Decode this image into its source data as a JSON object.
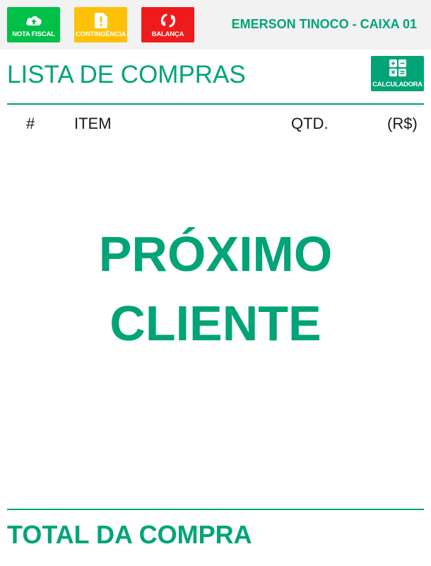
{
  "colors": {
    "primary": "#00a477",
    "nota_fiscal": "#00c04a",
    "contingencia": "#ffc107",
    "balanca": "#ef1b1b",
    "topbar_bg": "#f2f2f2"
  },
  "toolbar": {
    "nota_fiscal": {
      "label": "NOTA FISCAL",
      "icon": "cloud-upload-icon"
    },
    "contingencia": {
      "label": "CONTINGÊNCIA",
      "icon": "alert-file-icon"
    },
    "balanca": {
      "label": "BALANÇA",
      "icon": "refresh-icon"
    }
  },
  "operator": "EMERSON TINOCO - CAIXA 01",
  "list": {
    "title": "LISTA DE COMPRAS",
    "calculator": {
      "label": "CALCULADORA",
      "icon": "calculator-icon"
    },
    "columns": {
      "number": "#",
      "item": "ITEM",
      "quantity": "QTD.",
      "price": "(R$)"
    },
    "rows": []
  },
  "status": {
    "line1": "PRÓXIMO",
    "line2": "CLIENTE"
  },
  "total": {
    "label": "TOTAL DA COMPRA"
  }
}
